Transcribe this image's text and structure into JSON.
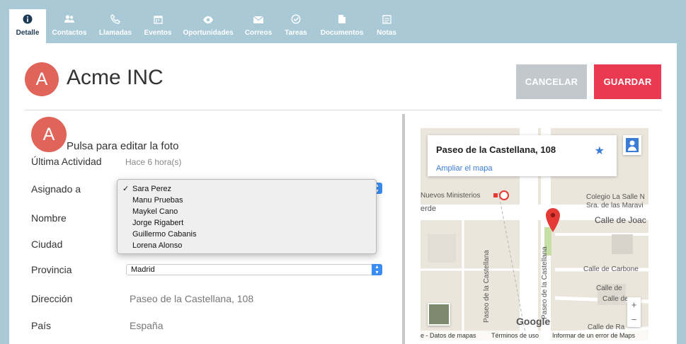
{
  "tabs": [
    {
      "label": "Detalle",
      "icon": "info-icon",
      "active": true
    },
    {
      "label": "Contactos",
      "icon": "users-icon"
    },
    {
      "label": "Llamadas",
      "icon": "phone-icon"
    },
    {
      "label": "Eventos",
      "icon": "calendar-icon"
    },
    {
      "label": "Oportunidades",
      "icon": "eye-icon"
    },
    {
      "label": "Correos",
      "icon": "mail-icon"
    },
    {
      "label": "Tareas",
      "icon": "check-circle-icon"
    },
    {
      "label": "Documentos",
      "icon": "document-icon"
    },
    {
      "label": "Notas",
      "icon": "notes-icon"
    }
  ],
  "header": {
    "avatar_letter": "A",
    "title": "Acme INC",
    "cancel_label": "CANCELAR",
    "save_label": "GUARDAR"
  },
  "photo": {
    "avatar_letter": "A",
    "hint": "Pulsa para editar la foto"
  },
  "fields": {
    "last_activity": {
      "label": "Última Actividad",
      "value": "Hace 6 hora(s)"
    },
    "assigned": {
      "label": "Asignado a"
    },
    "name": {
      "label": "Nombre"
    },
    "city": {
      "label": "Ciudad"
    },
    "province": {
      "label": "Provincia",
      "value": "Madrid"
    },
    "address": {
      "label": "Dirección",
      "value": "Paseo de la Castellana, 108"
    },
    "country": {
      "label": "País",
      "value": "España"
    }
  },
  "assignee_options": [
    {
      "label": "Sara Perez",
      "checked": true
    },
    {
      "label": "Manu Pruebas"
    },
    {
      "label": "Maykel Cano"
    },
    {
      "label": "Jorge Rigabert"
    },
    {
      "label": "Guillermo Cabanis"
    },
    {
      "label": "Lorena Alonso"
    }
  ],
  "map": {
    "card_title": "Paseo de la Castellana, 108",
    "card_link": "Ampliar el mapa",
    "labels": {
      "nuevos": "Nuevos Ministerios",
      "verde": "erde",
      "colegio1": "Colegio La Salle N",
      "colegio2": "Sra. de las Maravi",
      "joaq": "Calle de Joac",
      "carbonero": "Calle de Carbone",
      "calle3": "Calle de",
      "calle4": "Calle de",
      "castellana1": "Paseo de la Castellana",
      "castellana2": "Paseo de la Castellana",
      "calle_bottom": "Calle de Ra"
    },
    "google_logo": "Google",
    "footer": {
      "data": "e - Datos de mapas",
      "terms": "Términos de uso",
      "report": "Informar de un error de Maps"
    }
  },
  "colors": {
    "accent": "#ea3a52",
    "avatar": "#e0645a",
    "tab_bar": "#a9c9d6",
    "link": "#3a7bd5"
  }
}
